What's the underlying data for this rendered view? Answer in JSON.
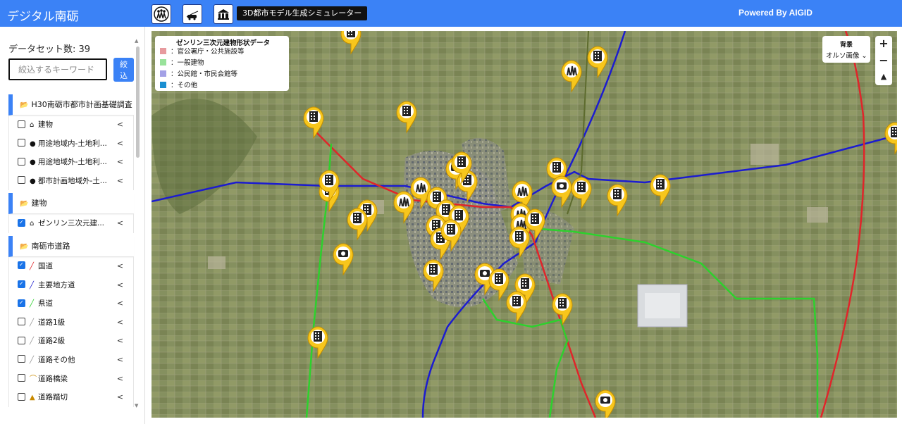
{
  "header": {
    "app_title": "デジタル南砺",
    "simulator_button": "3D都市モデル生成シミュレーター",
    "powered_by": "Powered By AIGID",
    "tool_icons": [
      "people-crowd-icon",
      "vehicle-road-icon",
      "building-van-icon"
    ]
  },
  "sidebar": {
    "dataset_count": "データセット数: 39",
    "search_placeholder": "絞込するキーワード",
    "filter_button": "絞込",
    "groups": [
      {
        "title": "H30南砺市都市計画基礎調査",
        "items": [
          {
            "label": "建物",
            "checked": false,
            "icon": "building-outline-icon"
          },
          {
            "label": "用途地域内-土地利...",
            "checked": false,
            "icon": "dot-icon"
          },
          {
            "label": "用途地域外-土地利...",
            "checked": false,
            "icon": "dot-icon"
          },
          {
            "label": "都市計画地域外-土...",
            "checked": false,
            "icon": "dot-icon"
          }
        ]
      },
      {
        "title": "建物",
        "items": [
          {
            "label": "ゼンリン三次元建...",
            "checked": true,
            "icon": "building-outline-icon"
          }
        ]
      },
      {
        "title": "南砺市道路",
        "items": [
          {
            "label": "国道",
            "checked": true,
            "icon": "line-red-icon"
          },
          {
            "label": "主要地方道",
            "checked": true,
            "icon": "line-blue-icon"
          },
          {
            "label": "県道",
            "checked": true,
            "icon": "line-green-icon"
          },
          {
            "label": "道路1級",
            "checked": false,
            "icon": "line-gray-icon"
          },
          {
            "label": "道路2級",
            "checked": false,
            "icon": "line-gray-icon"
          },
          {
            "label": "道路その他",
            "checked": false,
            "icon": "line-gray-icon"
          },
          {
            "label": "道路橋梁",
            "checked": false,
            "icon": "bridge-icon"
          },
          {
            "label": "道路踏切",
            "checked": false,
            "icon": "crossing-icon"
          }
        ]
      }
    ]
  },
  "legend": {
    "title": "ゼンリン三次元建物形状データ",
    "entries": [
      {
        "label": "：官公署庁・公共施設等",
        "color": "#e79a9e"
      },
      {
        "label": "：一般建物",
        "color": "#98e29a"
      },
      {
        "label": "：公民館・市民会館等",
        "color": "#a3a1e6"
      },
      {
        "label": "：その他",
        "color": "#1a8fd1"
      }
    ]
  },
  "map_controls": {
    "background_label": "背景",
    "background_value": "オルソ画像",
    "zoom_in": "+",
    "zoom_out": "−"
  },
  "colors": {
    "header_blue": "#3b82f6",
    "marker_yellow": "#f7c61c",
    "road_national": "#e0252a",
    "road_main_local": "#1c1ccf",
    "road_prefectural": "#2dd12d"
  }
}
